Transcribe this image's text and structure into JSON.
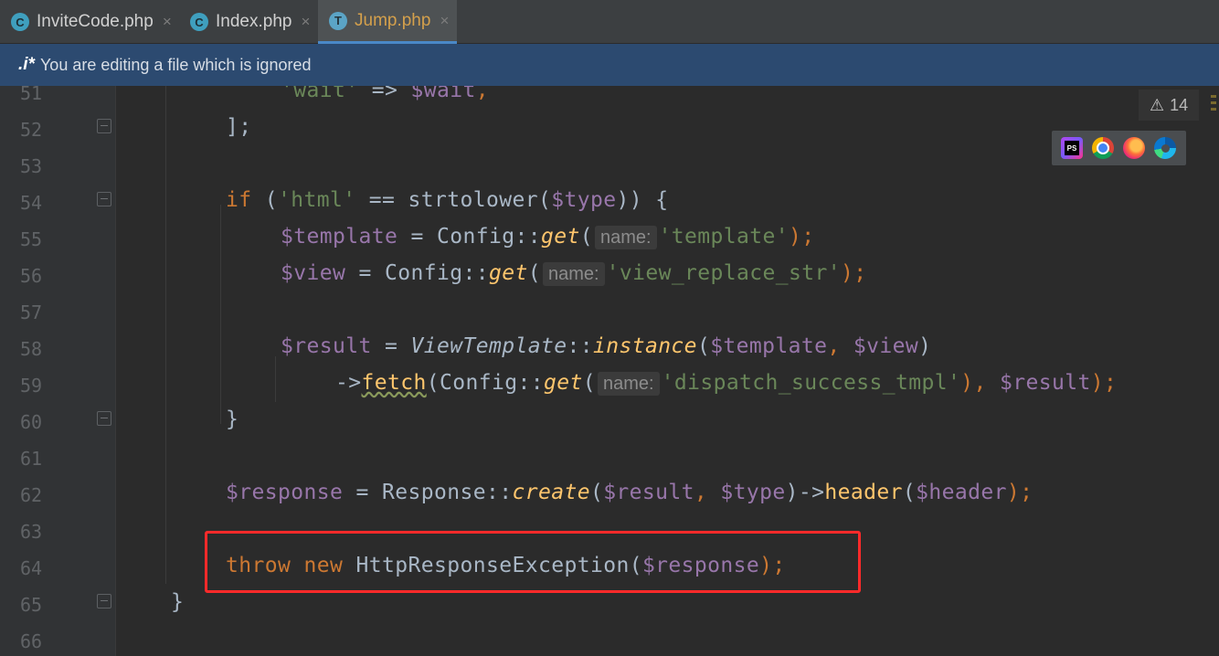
{
  "tabs": [
    {
      "label": "InviteCode.php",
      "icon": "C",
      "active": false
    },
    {
      "label": "Index.php",
      "icon": "C",
      "active": false
    },
    {
      "label": "Jump.php",
      "icon": "T",
      "active": true
    }
  ],
  "close_glyph": "×",
  "banner": {
    "icon": ".i*",
    "text": "You are editing a file which is ignored"
  },
  "inspections": {
    "warning_count": "14"
  },
  "browsers": [
    "phpstorm-icon",
    "chrome-icon",
    "firefox-icon",
    "edge-icon"
  ],
  "line_numbers": [
    "51",
    "52",
    "53",
    "54",
    "55",
    "56",
    "57",
    "58",
    "59",
    "60",
    "61",
    "62",
    "63",
    "64",
    "65",
    "66"
  ],
  "code": {
    "l51": {
      "str": "'wait'",
      "op": " => ",
      "var": "$wait",
      "end": ","
    },
    "l52": {
      "text": "];"
    },
    "l54": {
      "kw": "if",
      "p1": " (",
      "str": "'html'",
      "op": " == ",
      "fn": "strtolower(",
      "var": "$type",
      "end": ")) {"
    },
    "l55": {
      "var": "$template",
      "op": " = Config::",
      "fn": "get",
      "p": "(",
      "hint": "name:",
      "str": "'template'",
      "end": ");"
    },
    "l56": {
      "var": "$view",
      "op": " = Config::",
      "fn": "get",
      "p": "(",
      "hint": "name:",
      "str": "'view_replace_str'",
      "end": ");"
    },
    "l58": {
      "var": "$result",
      "op": " = ",
      "cls": "ViewTemplate",
      "sep": "::",
      "fn": "instance",
      "p": "(",
      "a1": "$template",
      "c": ", ",
      "a2": "$view",
      "end": ")"
    },
    "l59": {
      "arrow": "->",
      "fn": "fetch",
      "p": "(Config::",
      "fn2": "get",
      "p2": "(",
      "hint": "name:",
      "str": "'dispatch_success_tmpl'",
      "c": "), ",
      "var": "$result",
      "end": ");"
    },
    "l60": {
      "text": "}"
    },
    "l62": {
      "var": "$response",
      "op": " = Response::",
      "fn": "create",
      "p": "(",
      "a1": "$result",
      "c": ", ",
      "a2": "$type",
      "p2": ")->",
      "fn2": "header",
      "p3": "(",
      "a3": "$header",
      "end": ");"
    },
    "l64": {
      "kw1": "throw",
      "sp": " ",
      "kw2": "new",
      "cls": " HttpResponseException(",
      "var": "$response",
      "end": ");"
    },
    "l65": {
      "text": "}"
    }
  },
  "colors": {
    "string": "#6a8759",
    "variable": "#9876aa",
    "keyword": "#cc7832",
    "function": "#ffc66d",
    "highlight": "#ff2a2a"
  }
}
